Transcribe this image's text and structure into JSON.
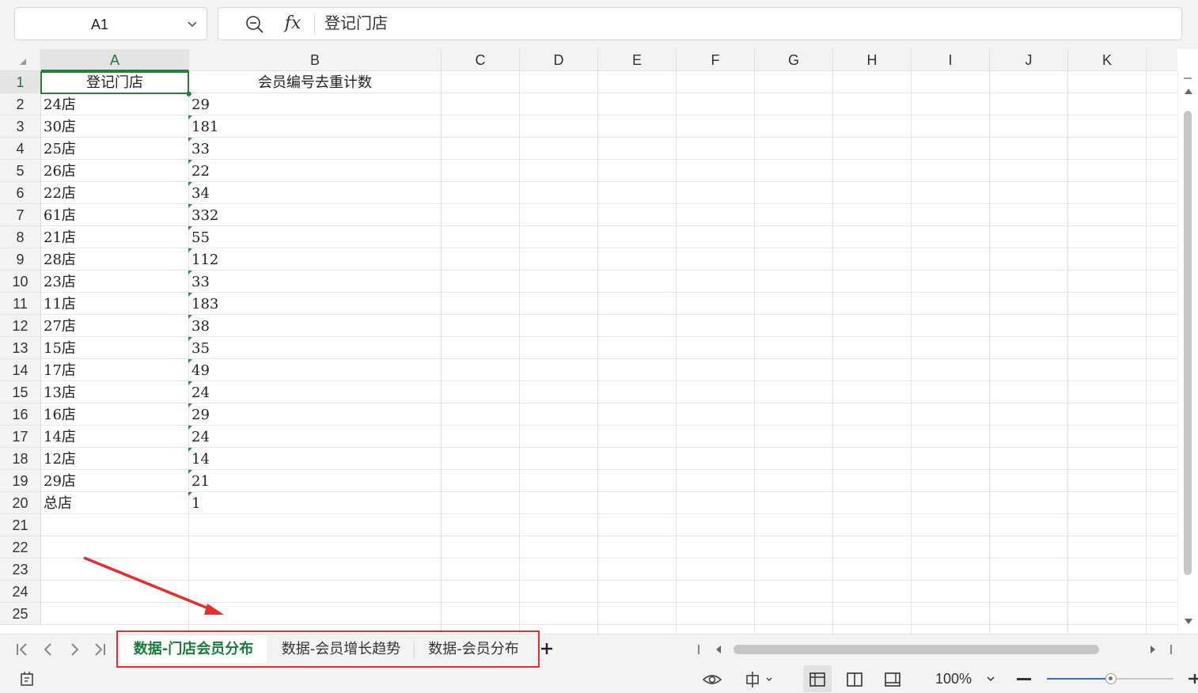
{
  "formula_bar": {
    "name_box": "A1",
    "formula_value": "登记门店",
    "fx_label": "fx"
  },
  "columns": [
    "A",
    "B",
    "C",
    "D",
    "E",
    "F",
    "G",
    "H",
    "I",
    "J",
    "K"
  ],
  "selected_column": "A",
  "rows": [
    "1",
    "2",
    "3",
    "4",
    "5",
    "6",
    "7",
    "8",
    "9",
    "10",
    "11",
    "12",
    "13",
    "14",
    "15",
    "16",
    "17",
    "18",
    "19",
    "20",
    "21",
    "22",
    "23",
    "24",
    "25"
  ],
  "selected_row": "1",
  "header_row": {
    "a": "登记门店",
    "b": "会员编号去重计数"
  },
  "data_rows": [
    {
      "store": "24店",
      "count": "29"
    },
    {
      "store": "30店",
      "count": "181"
    },
    {
      "store": "25店",
      "count": "33"
    },
    {
      "store": "26店",
      "count": "22"
    },
    {
      "store": "22店",
      "count": "34"
    },
    {
      "store": "61店",
      "count": "332"
    },
    {
      "store": "21店",
      "count": "55"
    },
    {
      "store": "28店",
      "count": "112"
    },
    {
      "store": "23店",
      "count": "33"
    },
    {
      "store": "11店",
      "count": "183"
    },
    {
      "store": "27店",
      "count": "38"
    },
    {
      "store": "15店",
      "count": "35"
    },
    {
      "store": "17店",
      "count": "49"
    },
    {
      "store": "13店",
      "count": "24"
    },
    {
      "store": "16店",
      "count": "29"
    },
    {
      "store": "14店",
      "count": "24"
    },
    {
      "store": "12店",
      "count": "14"
    },
    {
      "store": "29店",
      "count": "21"
    },
    {
      "store": "总店",
      "count": "1"
    }
  ],
  "sheet_tabs": [
    {
      "label": "数据-门店会员分布",
      "active": true
    },
    {
      "label": "数据-会员增长趋势",
      "active": false
    },
    {
      "label": "数据-会员分布",
      "active": false
    }
  ],
  "status_bar": {
    "zoom_level": "100%"
  },
  "colors": {
    "accent_green": "#2a7d3a",
    "annotation_red": "#e0312f",
    "zoom_blue": "#2f6fd8"
  },
  "icons": [
    "chevron-down-icon",
    "zoom-icon",
    "first-sheet-icon",
    "prev-sheet-icon",
    "next-sheet-icon",
    "last-sheet-icon",
    "plus-icon",
    "macro-icon",
    "eye-icon",
    "focus-icon",
    "normal-view-icon",
    "page-break-view-icon",
    "page-layout-view-icon"
  ]
}
